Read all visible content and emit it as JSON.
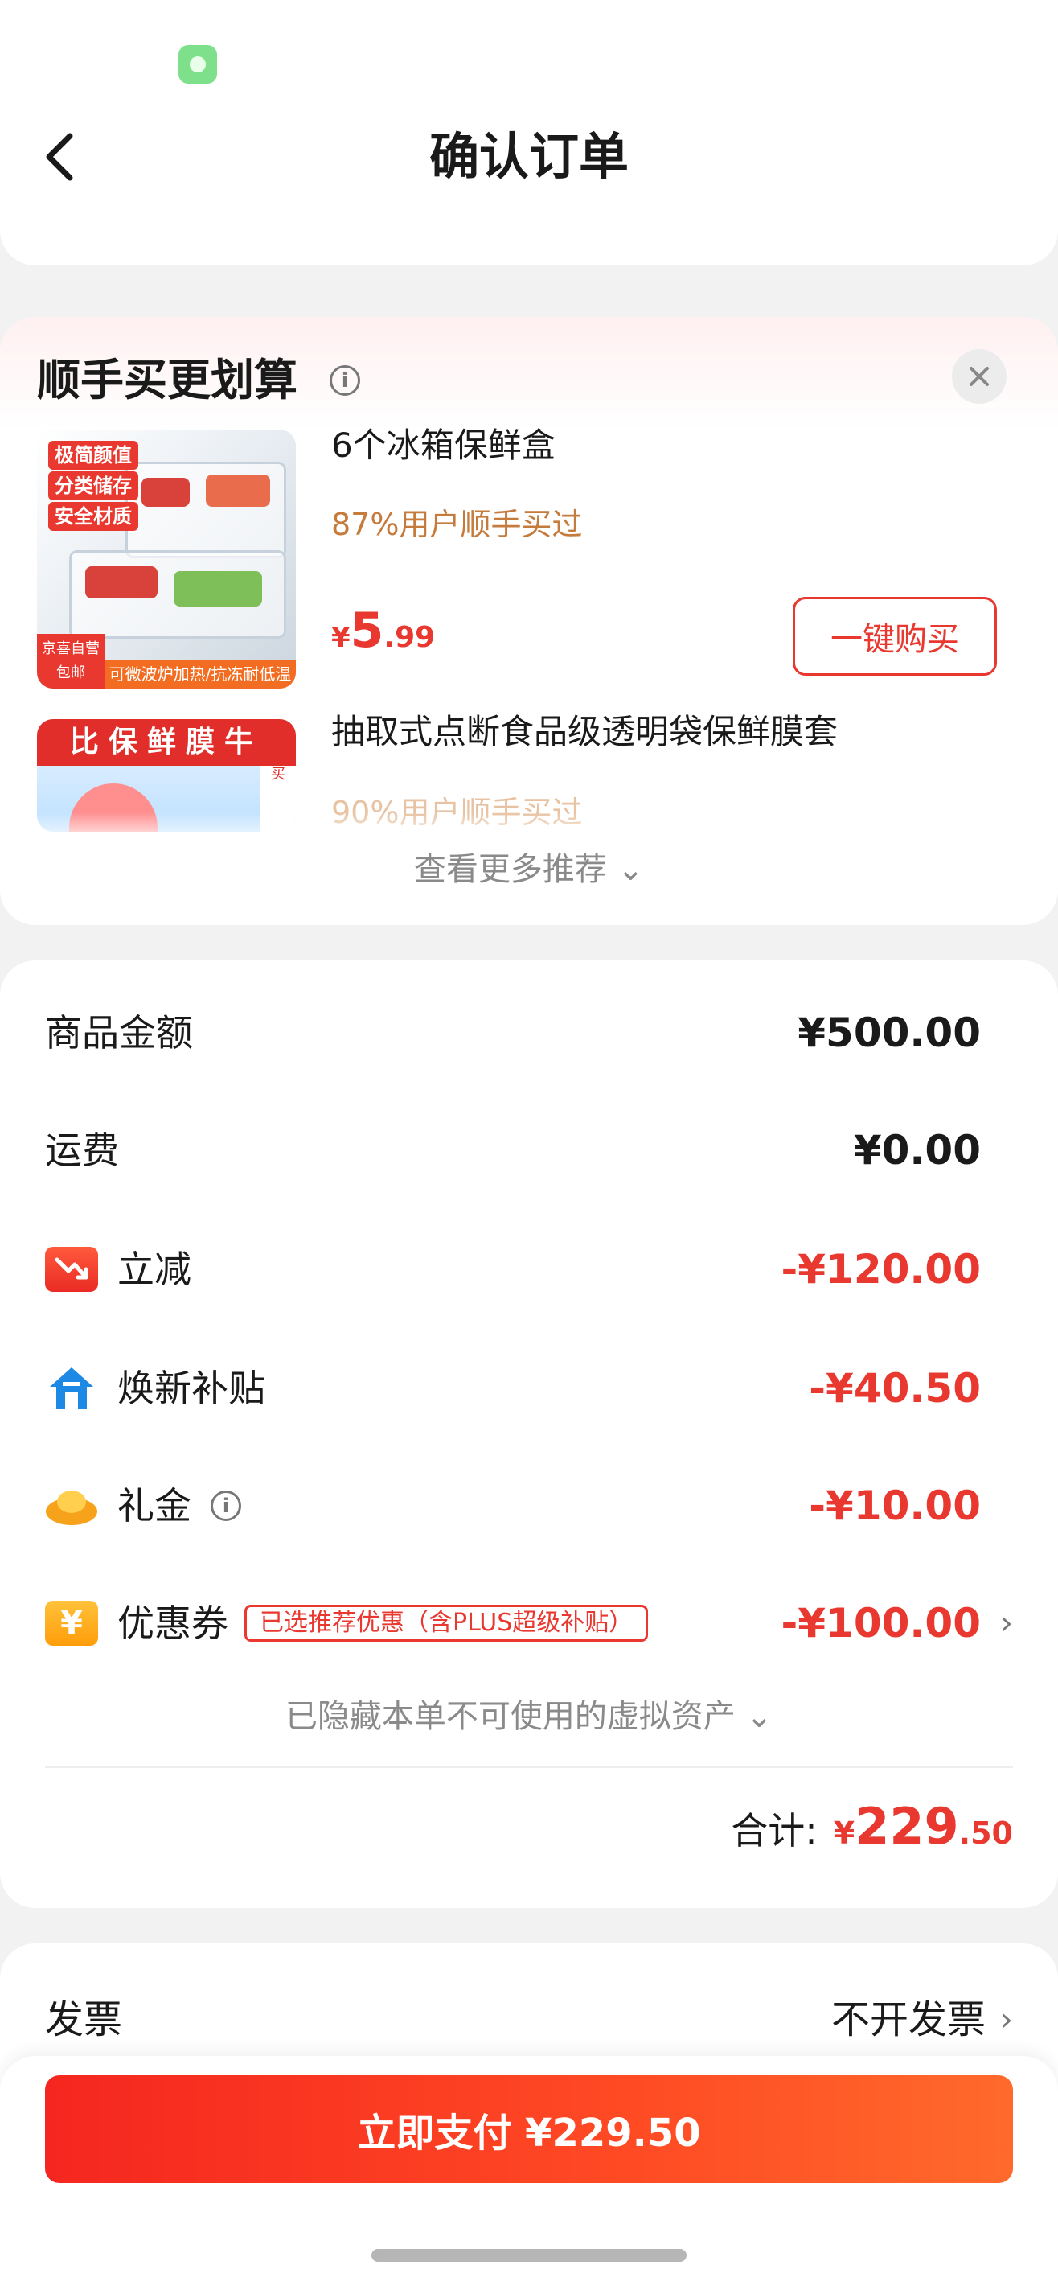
{
  "header": {
    "title": "确认订单"
  },
  "recommend": {
    "title": "顺手买更划算",
    "info_icon": "i",
    "items": [
      {
        "name": "6个冰箱保鲜盒",
        "note": "87%用户顺手买过",
        "price_currency": "¥",
        "price_int": "5",
        "price_dec": ".99",
        "buy_label": "一键购买",
        "img_tags": [
          "极简颜值",
          "分类储存",
          "安全材质"
        ],
        "img_badge": "京喜自营 包邮",
        "img_strip": "可微波炉加热/抗冻耐低温"
      },
      {
        "name": "抽取式点断食品级透明袋保鲜膜套",
        "note": "90%用户顺手买过",
        "img_banner": "比保鲜膜牛",
        "img_side": "买"
      }
    ],
    "more_label": "查看更多推荐 ⌄"
  },
  "pricing": {
    "rows": [
      {
        "label": "商品金额",
        "value": "¥500.00"
      },
      {
        "label": "运费",
        "value": "¥0.00"
      },
      {
        "label": "立减",
        "value": "-¥120.00",
        "icon": "price-down-icon"
      },
      {
        "label": "焕新补贴",
        "value": "-¥40.50",
        "icon": "house-icon"
      },
      {
        "label": "礼金",
        "value": "-¥10.00",
        "icon": "gold-ingot-icon"
      },
      {
        "label": "优惠券",
        "value": "-¥100.00",
        "icon": "coupon-icon",
        "tag": "已选推荐优惠（含PLUS超级补贴）"
      }
    ],
    "hidden_note": "已隐藏本单不可使用的虚拟资产 ⌄",
    "total_label": "合计:",
    "total_currency": "¥",
    "total_int": "229",
    "total_dec": ".50"
  },
  "invoice": {
    "label": "发票",
    "value": "不开发票"
  },
  "pay_button": "立即支付 ¥229.50",
  "colors": {
    "accent": "#e8382f",
    "orange": "#ff6a2b",
    "note": "#c47b3c"
  }
}
